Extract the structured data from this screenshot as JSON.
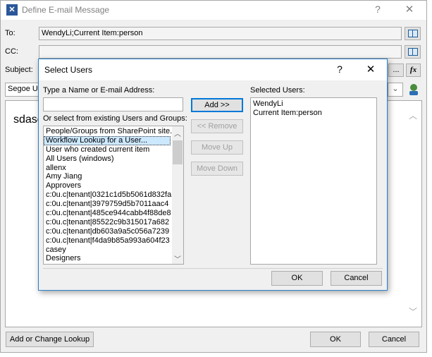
{
  "main_window": {
    "title": "Define E-mail Message",
    "help_glyph": "?",
    "close_glyph": "✕",
    "to_label": "To:",
    "to_value": "WendyLi;Current Item:person",
    "cc_label": "CC:",
    "cc_value": "",
    "subject_label": "Subject:",
    "subject_more_label": "...",
    "subject_fx_label": "fx",
    "font_value": "Segoe UI",
    "body_text": "sdasc",
    "add_lookup_label": "Add or Change Lookup",
    "ok_label": "OK",
    "cancel_label": "Cancel"
  },
  "select_users": {
    "title": "Select Users",
    "help_glyph": "?",
    "close_glyph": "✕",
    "type_label": "Type a Name or E-mail Address:",
    "type_value": "",
    "existing_label": "Or select from existing Users and Groups:",
    "existing_items": [
      "People/Groups from SharePoint site...",
      "Workflow Lookup for a User...",
      "User who created current item",
      "All Users (windows)",
      "allenx",
      "Amy Jiang",
      "Approvers",
      "c:0u.c|tenant|0321c1d5b5061d832fa",
      "c:0u.c|tenant|3979759d5b7011aac4",
      "c:0u.c|tenant|485ce944cabb4f88de8",
      "c:0u.c|tenant|85522c9b315017a682",
      "c:0u.c|tenant|db603a9a5c056a7239",
      "c:0u.c|tenant|f4da9b85a993a604f23",
      "casey",
      "Designers"
    ],
    "selected_existing_index": 1,
    "add_label": "Add >>",
    "remove_label": "<< Remove",
    "move_up_label": "Move Up",
    "move_down_label": "Move Down",
    "selected_users_label": "Selected Users:",
    "selected_users": [
      "WendyLi",
      "Current Item:person"
    ],
    "ok_label": "OK",
    "cancel_label": "Cancel"
  }
}
